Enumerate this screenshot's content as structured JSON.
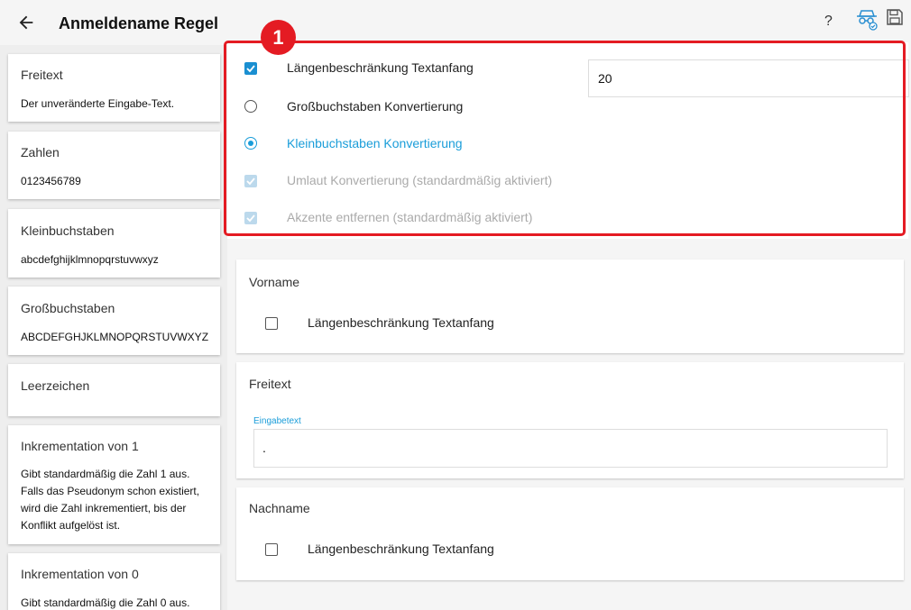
{
  "header": {
    "title": "Anmeldename Regel",
    "help": "?"
  },
  "sidebar": {
    "cards": [
      {
        "title": "Freitext",
        "desc": "Der unveränderte Eingabe-Text."
      },
      {
        "title": "Zahlen",
        "desc": "0123456789"
      },
      {
        "title": "Kleinbuchstaben",
        "desc": "abcdefghijklmnopqrstuvwxyz"
      },
      {
        "title": "Großbuchstaben",
        "desc": "ABCDEFGHJKLMNOPQRSTUVWXYZ"
      },
      {
        "title": "Leerzeichen",
        "desc": ""
      },
      {
        "title": "Inkrementation von 1",
        "desc": "Gibt standardmäßig die Zahl 1 aus. Falls das Pseudonym schon existiert, wird die Zahl inkrementiert, bis der Konflikt aufgelöst ist."
      },
      {
        "title": "Inkrementation von 0",
        "desc": "Gibt standardmäßig die Zahl 0 aus."
      }
    ]
  },
  "options": {
    "badge": "1",
    "limit": {
      "label": "Längenbeschränkung Textanfang",
      "value": "20"
    },
    "upper": {
      "label": "Großbuchstaben Konvertierung"
    },
    "lower": {
      "label": "Kleinbuchstaben Konvertierung"
    },
    "umlaut": {
      "label": "Umlaut Konvertierung (standardmäßig aktiviert)"
    },
    "accent": {
      "label": "Akzente entfernen (standardmäßig aktiviert)"
    }
  },
  "sections": {
    "vorname": {
      "title": "Vorname",
      "checkbox_label": "Längenbeschränkung Textanfang"
    },
    "freitext": {
      "title": "Freitext",
      "field_label": "Eingabetext",
      "field_value": "."
    },
    "nachname": {
      "title": "Nachname",
      "checkbox_label": "Längenbeschränkung Textanfang"
    }
  },
  "colors": {
    "accent": "#1a9dd9",
    "highlight": "#e41b23"
  }
}
